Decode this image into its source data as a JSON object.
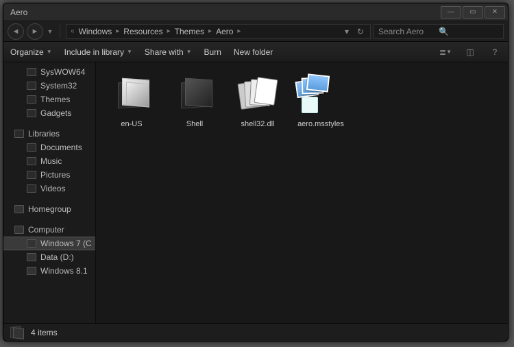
{
  "window": {
    "title": "Aero"
  },
  "nav": {
    "breadcrumb": [
      "Windows",
      "Resources",
      "Themes",
      "Aero"
    ],
    "search_placeholder": "Search Aero"
  },
  "toolbar": {
    "organize": "Organize",
    "include": "Include in library",
    "share": "Share with",
    "burn": "Burn",
    "newfolder": "New folder"
  },
  "sidebar": {
    "top_items": [
      "SysWOW64",
      "System32",
      "Themes",
      "Gadgets"
    ],
    "libraries_label": "Libraries",
    "libraries": [
      "Documents",
      "Music",
      "Pictures",
      "Videos"
    ],
    "homegroup_label": "Homegroup",
    "computer_label": "Computer",
    "drives": [
      "Windows 7 (C",
      "Data (D:)",
      "Windows 8.1"
    ]
  },
  "files": [
    {
      "name": "en-US",
      "type": "folder-bright"
    },
    {
      "name": "Shell",
      "type": "folder-dark"
    },
    {
      "name": "shell32.dll",
      "type": "dll"
    },
    {
      "name": "aero.msstyles",
      "type": "msstyles"
    }
  ],
  "status": {
    "count_text": "4 items"
  }
}
